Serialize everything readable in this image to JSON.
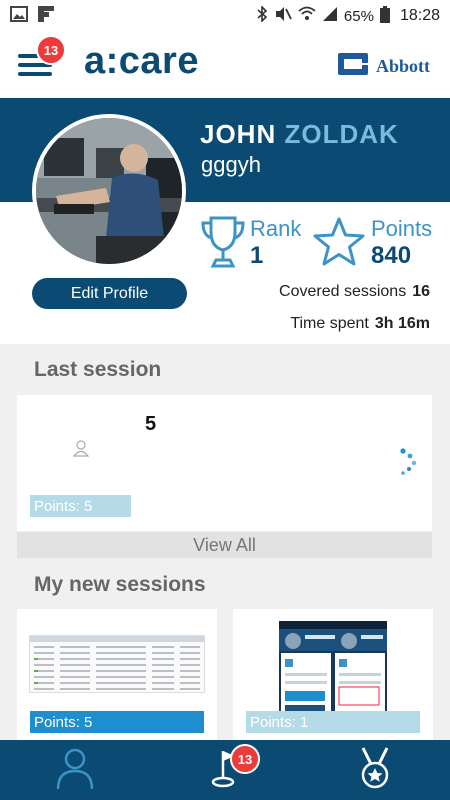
{
  "status_bar": {
    "battery": "65%",
    "time": "18:28",
    "left_icons": [
      "gallery-icon",
      "flipboard-icon"
    ],
    "right_icons": [
      "bluetooth-icon",
      "mute-icon",
      "wifi-icon",
      "signal-icon",
      "battery-icon"
    ]
  },
  "header": {
    "app_name": "a:care",
    "menu_badge": "13",
    "partner_name": "Abbott"
  },
  "profile": {
    "first_name": "JOHN",
    "last_name": "ZOLDAK",
    "username": "gggyh",
    "edit_label": "Edit Profile",
    "rank_label": "Rank",
    "rank_value": "1",
    "points_label": "Points",
    "points_value": "840",
    "covered_label": "Covered sessions",
    "covered_value": "16",
    "time_label": "Time spent",
    "time_value": "3h 16m"
  },
  "last_session": {
    "title": "Last session",
    "number": "5",
    "points_text": "Points: 5",
    "view_all": "View All"
  },
  "new_sessions": {
    "title": "My new sessions",
    "items": [
      {
        "points_text": "Points: 5"
      },
      {
        "points_text": "Points: 1"
      }
    ]
  },
  "bottom_nav": {
    "items": [
      "profile-icon",
      "golf-flag-icon",
      "medal-icon"
    ],
    "badge": "13"
  },
  "colors": {
    "primary": "#0b4a72",
    "accent": "#3c93c6",
    "light_accent": "#7cb9dd",
    "badge": "#ec3b3b",
    "points_tag_light": "#b5dbe8",
    "points_tag_dark": "#1e8ecf"
  }
}
